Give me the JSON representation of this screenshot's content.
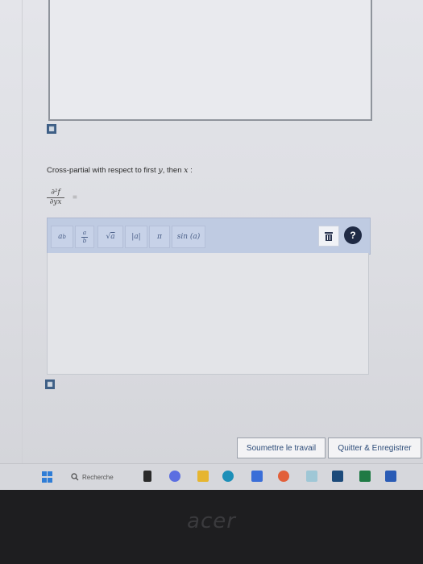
{
  "question": {
    "label_prefix": "Cross-partial with respect to first ",
    "var_y": "y",
    "label_mid": ", then ",
    "var_x": "x",
    "label_suffix": " :",
    "frac_numerator": "∂²f",
    "frac_denominator": "∂yx",
    "equals": "="
  },
  "toolbar": {
    "power_base": "a",
    "power_exp": "b",
    "frac_num": "a",
    "frac_den": "b",
    "sqrt_symbol": "√",
    "sqrt_arg": "a",
    "abs": "|a|",
    "pi": "π",
    "sin": "sin (a)",
    "help": "?"
  },
  "buttons": {
    "submit": "Soumettre le travail",
    "save_quit": "Quitter & Enregistrer"
  },
  "taskbar": {
    "search_label": "Recherche"
  },
  "bezel": {
    "brand": "acer"
  }
}
